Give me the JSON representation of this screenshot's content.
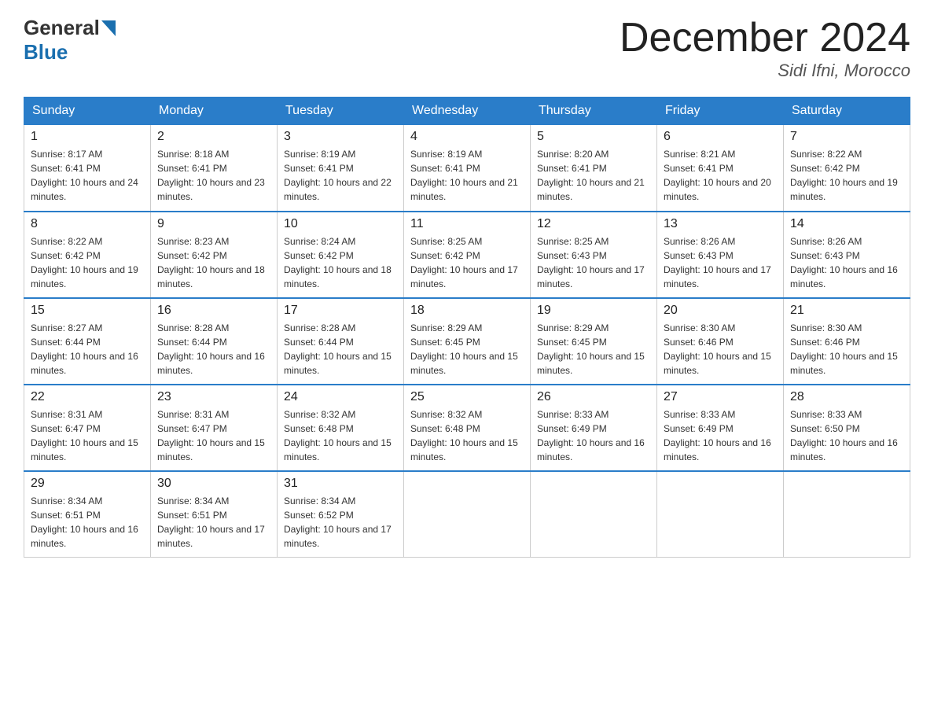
{
  "header": {
    "logo_general": "General",
    "logo_blue": "Blue",
    "month_title": "December 2024",
    "location": "Sidi Ifni, Morocco"
  },
  "weekdays": [
    "Sunday",
    "Monday",
    "Tuesday",
    "Wednesday",
    "Thursday",
    "Friday",
    "Saturday"
  ],
  "weeks": [
    [
      {
        "day": "1",
        "sunrise": "8:17 AM",
        "sunset": "6:41 PM",
        "daylight": "10 hours and 24 minutes."
      },
      {
        "day": "2",
        "sunrise": "8:18 AM",
        "sunset": "6:41 PM",
        "daylight": "10 hours and 23 minutes."
      },
      {
        "day": "3",
        "sunrise": "8:19 AM",
        "sunset": "6:41 PM",
        "daylight": "10 hours and 22 minutes."
      },
      {
        "day": "4",
        "sunrise": "8:19 AM",
        "sunset": "6:41 PM",
        "daylight": "10 hours and 21 minutes."
      },
      {
        "day": "5",
        "sunrise": "8:20 AM",
        "sunset": "6:41 PM",
        "daylight": "10 hours and 21 minutes."
      },
      {
        "day": "6",
        "sunrise": "8:21 AM",
        "sunset": "6:41 PM",
        "daylight": "10 hours and 20 minutes."
      },
      {
        "day": "7",
        "sunrise": "8:22 AM",
        "sunset": "6:42 PM",
        "daylight": "10 hours and 19 minutes."
      }
    ],
    [
      {
        "day": "8",
        "sunrise": "8:22 AM",
        "sunset": "6:42 PM",
        "daylight": "10 hours and 19 minutes."
      },
      {
        "day": "9",
        "sunrise": "8:23 AM",
        "sunset": "6:42 PM",
        "daylight": "10 hours and 18 minutes."
      },
      {
        "day": "10",
        "sunrise": "8:24 AM",
        "sunset": "6:42 PM",
        "daylight": "10 hours and 18 minutes."
      },
      {
        "day": "11",
        "sunrise": "8:25 AM",
        "sunset": "6:42 PM",
        "daylight": "10 hours and 17 minutes."
      },
      {
        "day": "12",
        "sunrise": "8:25 AM",
        "sunset": "6:43 PM",
        "daylight": "10 hours and 17 minutes."
      },
      {
        "day": "13",
        "sunrise": "8:26 AM",
        "sunset": "6:43 PM",
        "daylight": "10 hours and 17 minutes."
      },
      {
        "day": "14",
        "sunrise": "8:26 AM",
        "sunset": "6:43 PM",
        "daylight": "10 hours and 16 minutes."
      }
    ],
    [
      {
        "day": "15",
        "sunrise": "8:27 AM",
        "sunset": "6:44 PM",
        "daylight": "10 hours and 16 minutes."
      },
      {
        "day": "16",
        "sunrise": "8:28 AM",
        "sunset": "6:44 PM",
        "daylight": "10 hours and 16 minutes."
      },
      {
        "day": "17",
        "sunrise": "8:28 AM",
        "sunset": "6:44 PM",
        "daylight": "10 hours and 15 minutes."
      },
      {
        "day": "18",
        "sunrise": "8:29 AM",
        "sunset": "6:45 PM",
        "daylight": "10 hours and 15 minutes."
      },
      {
        "day": "19",
        "sunrise": "8:29 AM",
        "sunset": "6:45 PM",
        "daylight": "10 hours and 15 minutes."
      },
      {
        "day": "20",
        "sunrise": "8:30 AM",
        "sunset": "6:46 PM",
        "daylight": "10 hours and 15 minutes."
      },
      {
        "day": "21",
        "sunrise": "8:30 AM",
        "sunset": "6:46 PM",
        "daylight": "10 hours and 15 minutes."
      }
    ],
    [
      {
        "day": "22",
        "sunrise": "8:31 AM",
        "sunset": "6:47 PM",
        "daylight": "10 hours and 15 minutes."
      },
      {
        "day": "23",
        "sunrise": "8:31 AM",
        "sunset": "6:47 PM",
        "daylight": "10 hours and 15 minutes."
      },
      {
        "day": "24",
        "sunrise": "8:32 AM",
        "sunset": "6:48 PM",
        "daylight": "10 hours and 15 minutes."
      },
      {
        "day": "25",
        "sunrise": "8:32 AM",
        "sunset": "6:48 PM",
        "daylight": "10 hours and 15 minutes."
      },
      {
        "day": "26",
        "sunrise": "8:33 AM",
        "sunset": "6:49 PM",
        "daylight": "10 hours and 16 minutes."
      },
      {
        "day": "27",
        "sunrise": "8:33 AM",
        "sunset": "6:49 PM",
        "daylight": "10 hours and 16 minutes."
      },
      {
        "day": "28",
        "sunrise": "8:33 AM",
        "sunset": "6:50 PM",
        "daylight": "10 hours and 16 minutes."
      }
    ],
    [
      {
        "day": "29",
        "sunrise": "8:34 AM",
        "sunset": "6:51 PM",
        "daylight": "10 hours and 16 minutes."
      },
      {
        "day": "30",
        "sunrise": "8:34 AM",
        "sunset": "6:51 PM",
        "daylight": "10 hours and 17 minutes."
      },
      {
        "day": "31",
        "sunrise": "8:34 AM",
        "sunset": "6:52 PM",
        "daylight": "10 hours and 17 minutes."
      },
      null,
      null,
      null,
      null
    ]
  ]
}
